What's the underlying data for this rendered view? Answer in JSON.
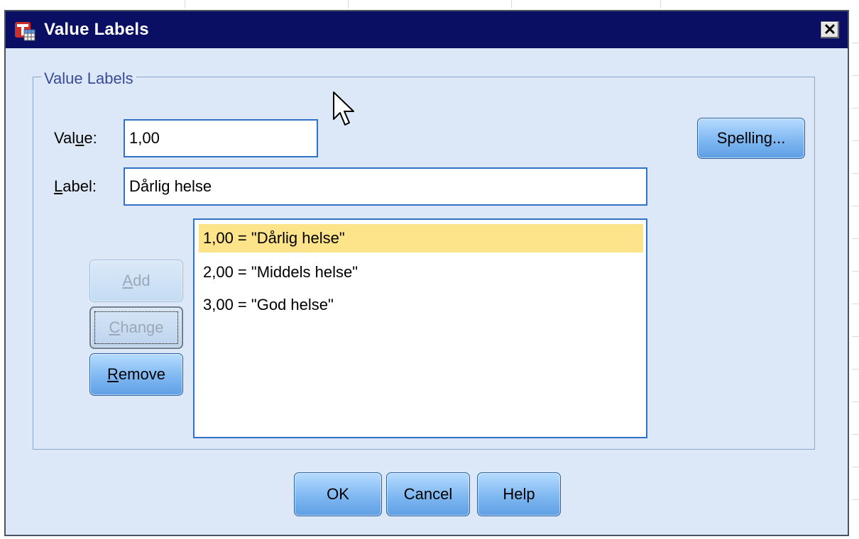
{
  "dialog": {
    "title": "Value Labels",
    "close_glyph": "✕"
  },
  "group": {
    "legend": "Value Labels"
  },
  "value_field": {
    "label_pre": "Val",
    "label_mnemonic": "u",
    "label_post": "e:",
    "value": "1,00"
  },
  "label_field": {
    "label_mnemonic": "L",
    "label_post": "abel:",
    "value": "Dårlig helse"
  },
  "list": {
    "items": [
      "1,00 = \"Dårlig helse\"",
      "2,00 = \"Middels helse\"",
      "3,00 = \"God helse\""
    ],
    "selected_index": 0
  },
  "buttons": {
    "add": {
      "mnemonic": "A",
      "rest": "dd"
    },
    "change": {
      "mnemonic": "C",
      "rest": "hange"
    },
    "remove": {
      "mnemonic": "R",
      "rest": "emove"
    },
    "spelling": "Spelling...",
    "ok": "OK",
    "cancel": "Cancel",
    "help": "Help"
  },
  "colors": {
    "titlebar": "#0b0f63",
    "dialog_bg": "#dce8f7",
    "selection": "#fde38a",
    "accent": "#2f72c8"
  }
}
